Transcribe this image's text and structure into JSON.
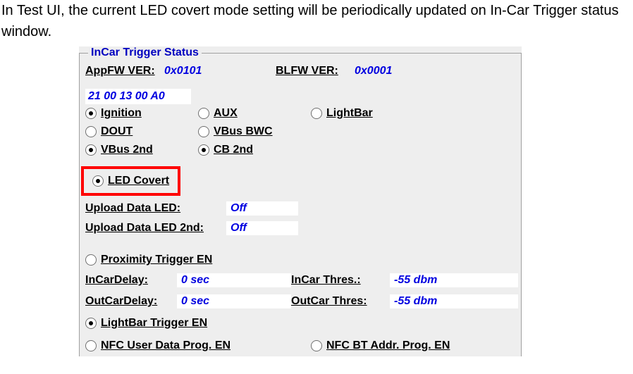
{
  "intro": "In Test UI, the current LED covert mode setting will be periodically updated on In-Car Trigger status window.",
  "panel": {
    "legend": "InCar Trigger Status",
    "appfw": {
      "label": "AppFW VER:",
      "value": "0x0101"
    },
    "blfw": {
      "label": "BLFW VER:",
      "value": "0x0001"
    },
    "rawhex": "21 00 13 00 A0",
    "radios1": {
      "ignition": {
        "label": "Ignition",
        "checked": true
      },
      "aux": {
        "label": "AUX",
        "checked": false
      },
      "lightbar": {
        "label": "LightBar",
        "checked": false
      },
      "dout": {
        "label": "DOUT",
        "checked": false
      },
      "vbusbwc": {
        "label": "VBus BWC",
        "checked": false
      },
      "vbus2nd": {
        "label": "VBus 2nd",
        "checked": true
      },
      "cb2nd": {
        "label": "CB 2nd",
        "checked": true
      }
    },
    "ledcovert": {
      "label": "LED Covert",
      "checked": true
    },
    "uploadLed": {
      "label": "Upload Data LED:",
      "value": "Off"
    },
    "uploadLed2nd": {
      "label": "Upload Data LED 2nd:",
      "value": "Off"
    },
    "proximity": {
      "label": "Proximity Trigger EN",
      "checked": false
    },
    "incardelay": {
      "label": "InCarDelay:",
      "value": "0 sec"
    },
    "incarthres": {
      "label": "InCar Thres.:",
      "value": "-55 dbm"
    },
    "outcardelay": {
      "label": "OutCarDelay:",
      "value": "0 sec"
    },
    "outcarthres": {
      "label": "OutCar Thres:",
      "value": "-55 dbm"
    },
    "lightbarTrig": {
      "label": "LightBar Trigger EN",
      "checked": true
    },
    "nfcUser": {
      "label": "NFC User Data Prog. EN",
      "checked": false
    },
    "nfcBt": {
      "label": "NFC BT Addr. Prog. EN",
      "checked": false
    }
  }
}
